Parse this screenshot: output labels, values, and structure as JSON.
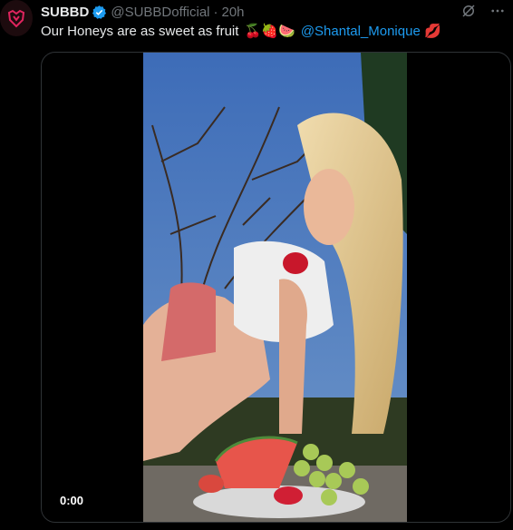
{
  "post": {
    "author_name": "SUBBD",
    "author_handle": "@SUBBDofficial",
    "separator": "·",
    "time_ago": "20h",
    "text_main": "Our Honeys are as sweet as fruit",
    "emojis_mid": "🍒🍓🍉",
    "mention": "@Shantal_Monique",
    "emoji_end": "💋"
  },
  "video": {
    "elapsed": "0:00"
  },
  "icons": {
    "avatar": "subbd-logo-icon",
    "verified": "verified-badge-icon",
    "grok": "grok-icon",
    "more": "more-options-icon"
  },
  "colors": {
    "accent": "#1d9bf0",
    "brand": "#e0245e",
    "background": "#000000"
  }
}
